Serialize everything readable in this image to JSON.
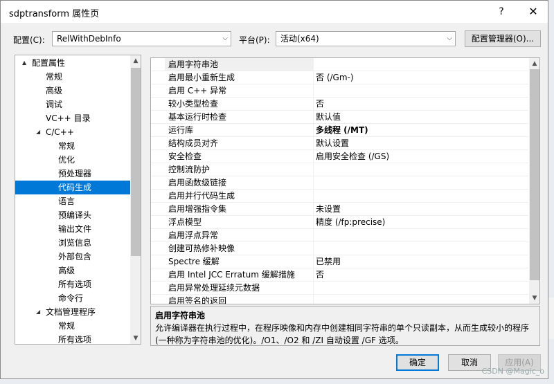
{
  "window": {
    "title": "sdptransform 属性页",
    "help": "?",
    "close": "✕"
  },
  "config": {
    "label": "配置(C):",
    "value": "RelWithDebInfo"
  },
  "platform": {
    "label": "平台(P):",
    "value": "活动(x64)"
  },
  "config_manager_label": "配置管理器(O)...",
  "tree": {
    "items": [
      {
        "label": "配置属性",
        "level": 0,
        "arrow": "▲"
      },
      {
        "label": "常规",
        "level": 1
      },
      {
        "label": "高级",
        "level": 1
      },
      {
        "label": "调试",
        "level": 1
      },
      {
        "label": "VC++ 目录",
        "level": 1
      },
      {
        "label": "C/C++",
        "level": 1,
        "arrow": "◢"
      },
      {
        "label": "常规",
        "level": 2
      },
      {
        "label": "优化",
        "level": 2
      },
      {
        "label": "预处理器",
        "level": 2
      },
      {
        "label": "代码生成",
        "level": 2,
        "selected": true
      },
      {
        "label": "语言",
        "level": 2
      },
      {
        "label": "预编译头",
        "level": 2
      },
      {
        "label": "输出文件",
        "level": 2
      },
      {
        "label": "浏览信息",
        "level": 2
      },
      {
        "label": "外部包含",
        "level": 2
      },
      {
        "label": "高级",
        "level": 2
      },
      {
        "label": "所有选项",
        "level": 2
      },
      {
        "label": "命令行",
        "level": 2
      },
      {
        "label": "文档管理程序",
        "level": 1,
        "arrow": "◢"
      },
      {
        "label": "常规",
        "level": 2
      },
      {
        "label": "所有选项",
        "level": 2
      }
    ]
  },
  "grid": {
    "rows": [
      {
        "name": "启用字符串池",
        "value": ""
      },
      {
        "name": "启用最小重新生成",
        "value": "否 (/Gm-)"
      },
      {
        "name": "启用 C++ 异常",
        "value": ""
      },
      {
        "name": "较小类型检查",
        "value": "否"
      },
      {
        "name": "基本运行时检查",
        "value": "默认值"
      },
      {
        "name": "运行库",
        "value": "多线程 (/MT)",
        "bold": true
      },
      {
        "name": "结构成员对齐",
        "value": "默认设置"
      },
      {
        "name": "安全检查",
        "value": "启用安全检查 (/GS)"
      },
      {
        "name": "控制流防护",
        "value": ""
      },
      {
        "name": "启用函数级链接",
        "value": ""
      },
      {
        "name": "启用并行代码生成",
        "value": ""
      },
      {
        "name": "启用增强指令集",
        "value": "未设置"
      },
      {
        "name": "浮点模型",
        "value": "精度 (/fp:precise)"
      },
      {
        "name": "启用浮点异常",
        "value": ""
      },
      {
        "name": "创建可热修补映像",
        "value": ""
      },
      {
        "name": "Spectre 缓解",
        "value": "已禁用"
      },
      {
        "name": "启用 Intel JCC Erratum 缓解措施",
        "value": "否"
      },
      {
        "name": "启用异常处理延续元数据",
        "value": ""
      },
      {
        "name": "启用签名的返回",
        "value": ""
      }
    ]
  },
  "description": {
    "title": "启用字符串池",
    "text": "允许编译器在执行过程中，在程序映像和内存中创建相同字符串的单个只读副本，从而生成较小的程序(一种称为字符串池的优化)。/O1、/O2 和 /ZI 自动设置 /GF 选项。"
  },
  "buttons": {
    "ok": "确定",
    "cancel": "取消",
    "apply": "应用(A)"
  },
  "watermark": "CSDN @Magic_o",
  "colors": {
    "selection": "#0078d7",
    "dialog_bg": "#f0f0f0"
  }
}
